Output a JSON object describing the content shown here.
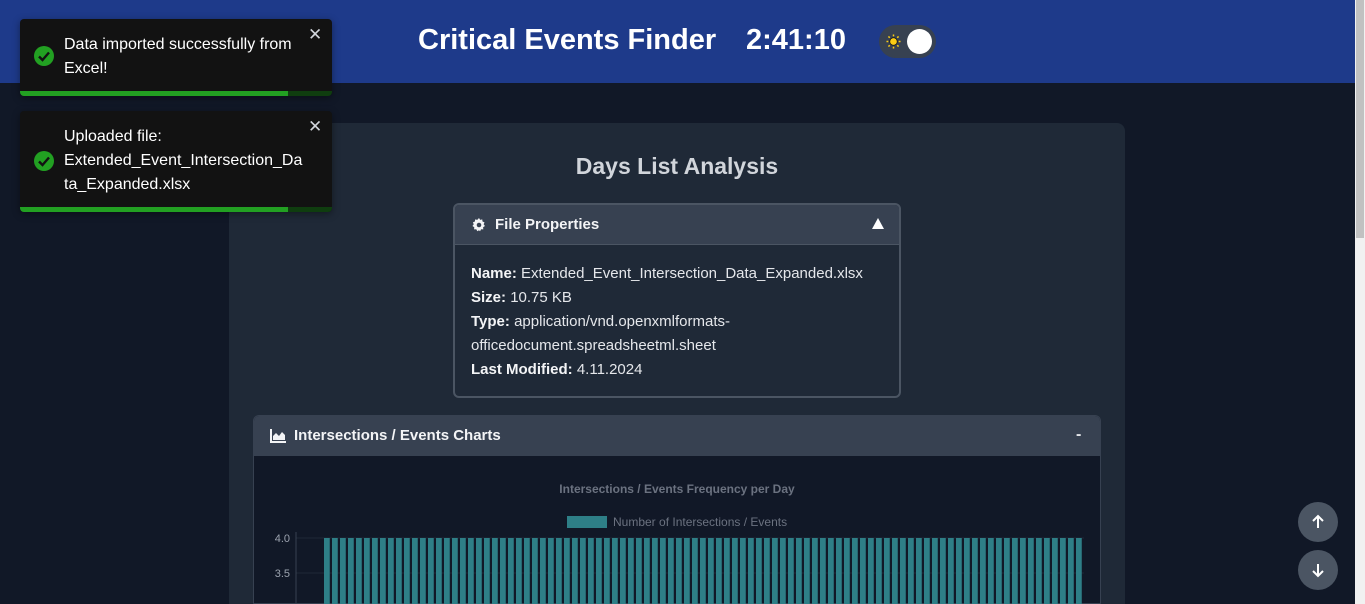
{
  "header": {
    "title": "Critical Events Finder",
    "clock": "2:41:10",
    "theme_toggle_icon": "sun-icon"
  },
  "main": {
    "title": "Days List Analysis"
  },
  "file_properties": {
    "header_label": "File Properties",
    "header_icon": "gear-icon",
    "toggle_icon": "caret-up-icon",
    "name_label": "Name:",
    "name_value": "Extended_Event_Intersection_Data_Expanded.xlsx",
    "size_label": "Size:",
    "size_value": "10.75 KB",
    "type_label": "Type:",
    "type_value_line1": "application/vnd.openxmlformats-",
    "type_value_line2": "officedocument.spreadsheetml.sheet",
    "modified_label": "Last Modified:",
    "modified_value": "4.11.2024"
  },
  "charts_panel": {
    "header_label": "Intersections / Events Charts",
    "header_icon": "area-chart-icon",
    "collapse_label": "-"
  },
  "toasts": [
    {
      "text": "Data imported successfully from Excel!",
      "icon": "check-circle-icon",
      "close": "✕",
      "progress": 0.86
    },
    {
      "text_line1": "Uploaded file:",
      "text_line2": "Extended_Event_Intersection_Data_Expanded.xlsx",
      "icon": "check-circle-icon",
      "close": "✕",
      "progress": 0.86
    }
  ],
  "fabs": {
    "up_icon": "arrow-up-icon",
    "down_icon": "arrow-down-icon"
  },
  "colors": {
    "header_bg": "#1e3a8a",
    "page_bg": "#111827",
    "bar_fill": "#2e7f87",
    "toast_success": "#22a022"
  },
  "chart_data": {
    "type": "bar",
    "title": "Intersections / Events Frequency per Day",
    "legend": "top",
    "series": [
      {
        "name": "Number of Intersections / Events",
        "values": [
          4,
          4,
          4,
          4,
          4,
          4,
          4,
          4,
          4,
          4,
          4,
          4,
          4,
          4,
          4,
          4,
          4,
          4,
          4,
          4,
          4,
          4,
          4,
          4,
          4,
          4,
          4,
          4,
          4,
          4,
          4,
          4,
          4,
          4,
          4,
          4,
          4,
          4,
          4,
          4,
          4,
          4,
          4,
          4,
          4,
          4,
          4,
          4,
          4,
          4,
          4,
          4,
          4,
          4,
          4,
          4,
          4,
          4,
          4,
          4,
          4,
          4,
          4,
          4,
          4,
          4,
          4,
          4,
          4,
          4,
          4,
          4,
          4,
          4,
          4,
          4,
          4,
          4,
          4,
          4,
          4,
          4,
          4,
          4,
          4,
          4,
          4,
          4,
          4,
          4,
          4,
          4,
          4,
          4,
          4
        ]
      }
    ],
    "y_ticks": [
      "4.0",
      "3.5"
    ],
    "ylim": [
      0,
      4
    ],
    "grid": true
  }
}
